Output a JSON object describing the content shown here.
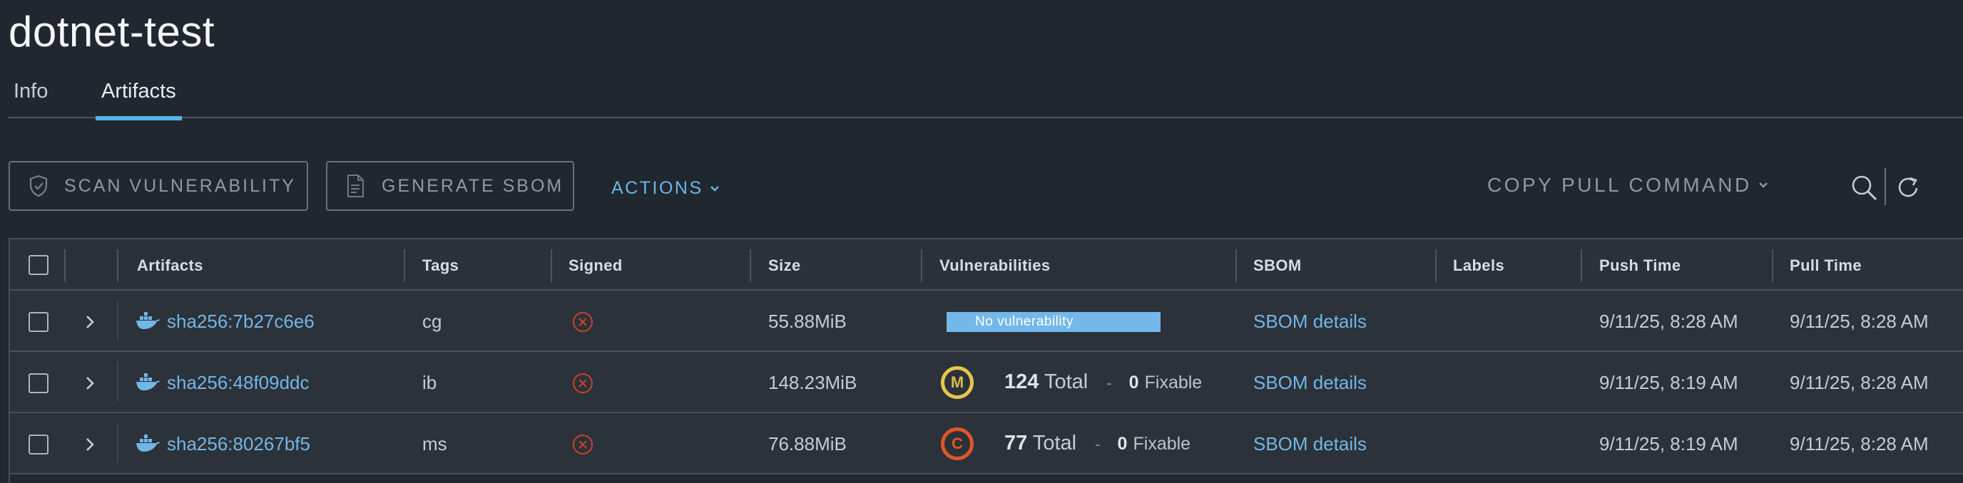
{
  "page": {
    "title": "dotnet-test"
  },
  "tabs": [
    {
      "label": "Info"
    },
    {
      "label": "Artifacts"
    }
  ],
  "toolbar": {
    "scan_label": "SCAN VULNERABILITY",
    "sbom_label": "GENERATE SBOM",
    "actions_label": "ACTIONS",
    "copy_label": "COPY PULL COMMAND"
  },
  "columns": {
    "artifacts": "Artifacts",
    "tags": "Tags",
    "signed": "Signed",
    "size": "Size",
    "vulnerabilities": "Vulnerabilities",
    "sbom": "SBOM",
    "labels": "Labels",
    "push_time": "Push Time",
    "pull_time": "Pull Time"
  },
  "rows": [
    {
      "digest": "sha256:7b27c6e6",
      "tag": "cg",
      "size": "55.88MiB",
      "vuln_label": "No vulnerability",
      "sbom": "SBOM details",
      "push_time": "9/11/25, 8:28 AM",
      "pull_time": "9/11/25, 8:28 AM"
    },
    {
      "digest": "sha256:48f09ddc",
      "tag": "ib",
      "size": "148.23MiB",
      "severity_letter": "M",
      "total_num": "124",
      "total_word": "Total",
      "dash": "-",
      "fixable_num": "0",
      "fixable_word": "Fixable",
      "sbom": "SBOM details",
      "push_time": "9/11/25, 8:19 AM",
      "pull_time": "9/11/25, 8:28 AM"
    },
    {
      "digest": "sha256:80267bf5",
      "tag": "ms",
      "size": "76.88MiB",
      "severity_letter": "C",
      "total_num": "77",
      "total_word": "Total",
      "dash": "-",
      "fixable_num": "0",
      "fixable_word": "Fixable",
      "sbom": "SBOM details",
      "push_time": "9/11/25, 8:19 AM",
      "pull_time": "9/11/25, 8:28 AM"
    }
  ],
  "icons": {
    "scan": "shield-check-icon",
    "sbom": "document-icon",
    "search": "search-icon",
    "refresh": "refresh-icon",
    "expand": "chevron-right-icon",
    "artifact": "docker-whale-icon",
    "unsigned": "x-circle-icon"
  },
  "colors": {
    "accent": "#5ab3e6",
    "link": "#73b6e6",
    "no_vuln_bar": "#74b7ea",
    "medium": "#e6c54b",
    "critical": "#e0552a",
    "unsigned": "#c7432b"
  }
}
